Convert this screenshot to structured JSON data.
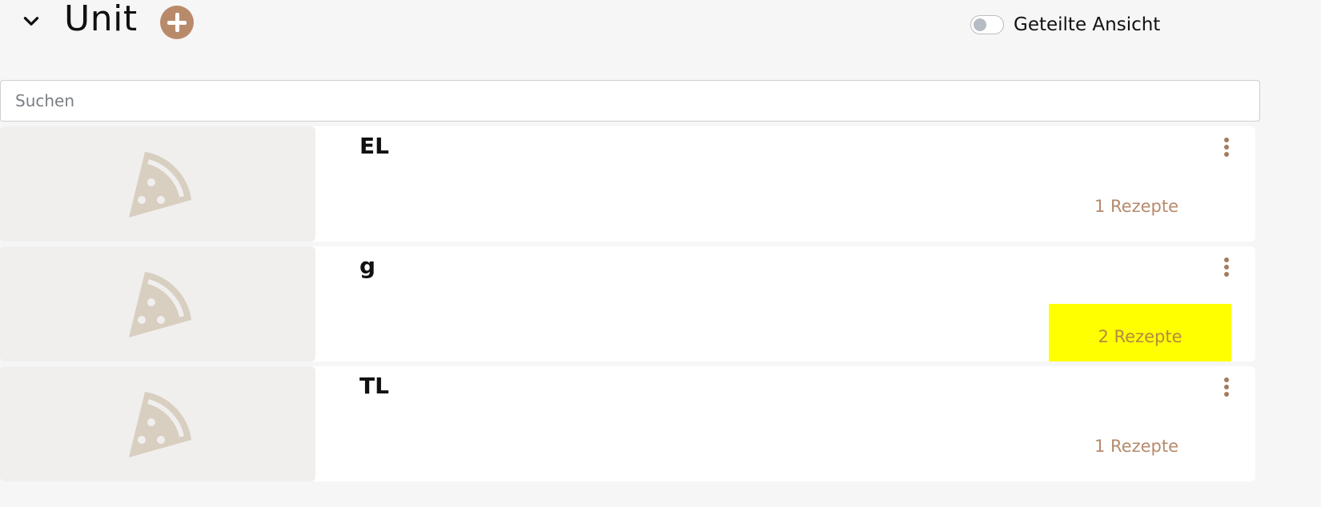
{
  "header": {
    "title": "Unit"
  },
  "split_view": {
    "label": "Geteilte Ansicht",
    "enabled": false
  },
  "search": {
    "placeholder": "Suchen",
    "value": ""
  },
  "items": [
    {
      "name": "EL",
      "count": "1 Rezepte"
    },
    {
      "name": "g",
      "count": "2 Rezepte",
      "highlighted": true
    },
    {
      "name": "TL",
      "count": "1 Rezepte"
    }
  ],
  "colors": {
    "accent": "#b98a6a",
    "highlight": "#ffff00",
    "placeholder_icon": "#d8cfc0"
  },
  "icons": [
    "chevron-down-icon",
    "plus-icon",
    "pizza-icon",
    "more-vertical-icon"
  ]
}
